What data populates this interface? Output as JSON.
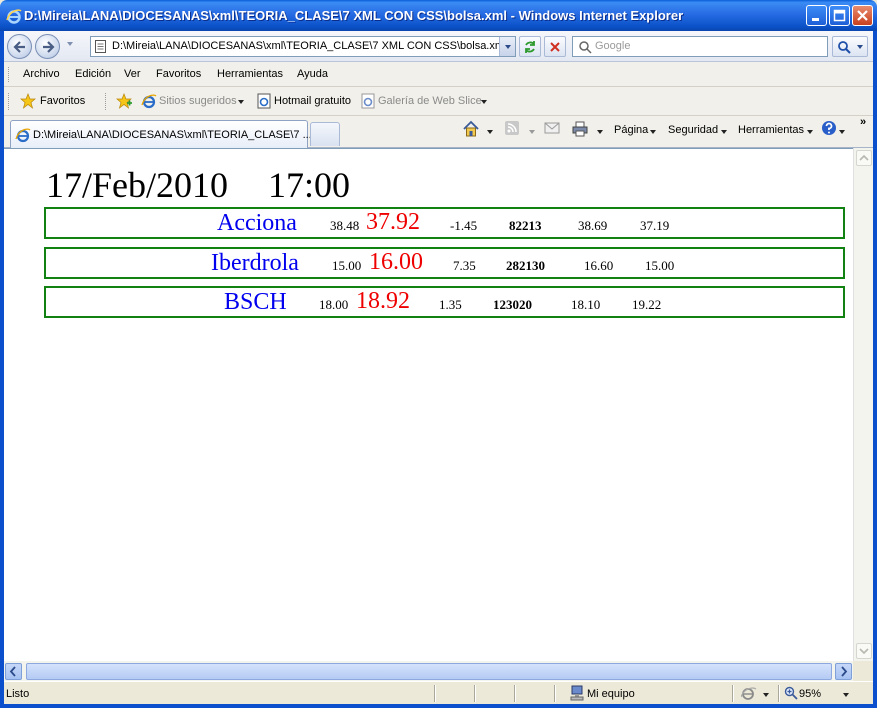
{
  "window": {
    "title": "D:\\Mireia\\LANA\\DIOCESANAS\\xml\\TEORIA_CLASE\\7 XML CON CSS\\bolsa.xml - Windows Internet Explorer"
  },
  "address": {
    "url": "D:\\Mireia\\LANA\\DIOCESANAS\\xml\\TEORIA_CLASE\\7 XML CON CSS\\bolsa.xml"
  },
  "search": {
    "placeholder": "Google"
  },
  "menu": {
    "items": [
      "Archivo",
      "Edición",
      "Ver",
      "Favoritos",
      "Herramientas",
      "Ayuda"
    ]
  },
  "favorites_bar": {
    "favorites": "Favoritos",
    "suggested": "Sitios sugeridos",
    "hotmail": "Hotmail gratuito",
    "webslice": "Galería de Web Slice"
  },
  "tab": {
    "label": "D:\\Mireia\\LANA\\DIOCESANAS\\xml\\TEORIA_CLASE\\7 ..."
  },
  "commands": {
    "page": "Página",
    "safety": "Seguridad",
    "tools": "Herramientas"
  },
  "page": {
    "date": "17/Feb/2010",
    "time": "17:00",
    "stocks": [
      {
        "name": "Acciona",
        "open": "38.48",
        "price": "37.92",
        "change": "-1.45",
        "volume": "82213",
        "high": "38.69",
        "low": "37.19"
      },
      {
        "name": "Iberdrola",
        "open": "15.00",
        "price": "16.00",
        "change": "7.35",
        "volume": "282130",
        "high": "16.60",
        "low": "15.00"
      },
      {
        "name": "BSCH",
        "open": "18.00",
        "price": "18.92",
        "change": "1.35",
        "volume": "123020",
        "high": "18.10",
        "low": "19.22"
      }
    ]
  },
  "status": {
    "text": "Listo",
    "zone": "Mi equipo",
    "zoom": "95%"
  },
  "colors": {
    "stock_name": "#0000EE",
    "price": "#EE0000",
    "border": "#118111"
  }
}
